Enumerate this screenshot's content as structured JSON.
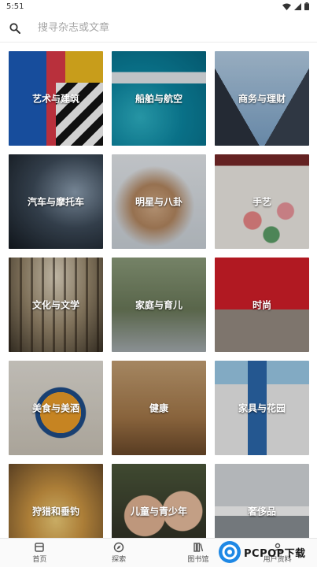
{
  "status_bar": {
    "time": "5:51"
  },
  "search": {
    "placeholder": "搜寻杂志或文章"
  },
  "categories": [
    {
      "label": "艺术与建筑"
    },
    {
      "label": "船舶与航空"
    },
    {
      "label": "商务与理财"
    },
    {
      "label": "汽车与摩托车"
    },
    {
      "label": "明星与八卦"
    },
    {
      "label": "手艺"
    },
    {
      "label": "文化与文学"
    },
    {
      "label": "家庭与育儿"
    },
    {
      "label": "时尚"
    },
    {
      "label": "美食与美酒"
    },
    {
      "label": "健康"
    },
    {
      "label": "家具与花园"
    },
    {
      "label": "狩猎和垂钓"
    },
    {
      "label": "儿童与青少年"
    },
    {
      "label": "奢侈品"
    }
  ],
  "bottom_nav": [
    {
      "label": "首页",
      "icon": "home-icon"
    },
    {
      "label": "探索",
      "icon": "compass-icon"
    },
    {
      "label": "图书馆",
      "icon": "library-icon"
    },
    {
      "label": "用户资料",
      "icon": "profile-icon"
    }
  ],
  "watermark": {
    "text": "PCPOP下载"
  }
}
